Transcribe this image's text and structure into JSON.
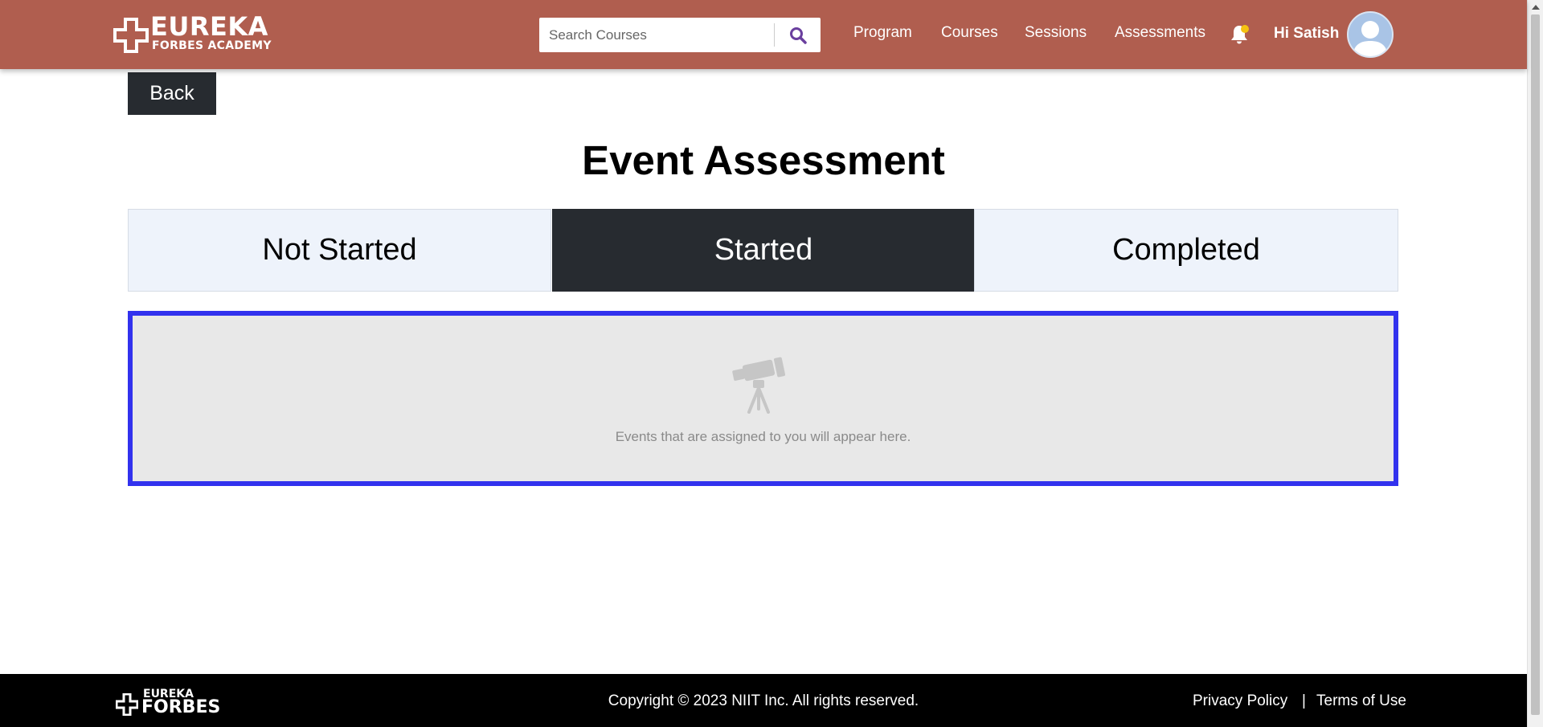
{
  "header": {
    "logo": {
      "title": "EUREKA",
      "subtitle": "FORBES ACADEMY"
    },
    "search": {
      "placeholder": "Search Courses",
      "value": ""
    },
    "nav": [
      {
        "label": "Program"
      },
      {
        "label": "Courses"
      },
      {
        "label": "Sessions"
      },
      {
        "label": "Assessments"
      }
    ],
    "greeting": "Hi Satish",
    "colors": {
      "bar": "#b05e4f",
      "search_icon": "#6a3f9e",
      "notification_dot": "#f5c211"
    }
  },
  "back_label": "Back",
  "page_title": "Event Assessment",
  "tabs": [
    {
      "label": "Not Started",
      "active": false
    },
    {
      "label": "Started",
      "active": true
    },
    {
      "label": "Completed",
      "active": false
    }
  ],
  "empty_state": {
    "icon": "telescope-icon",
    "message": "Events that are assigned to you will appear here.",
    "border_color": "#3232ee"
  },
  "footer": {
    "logo_top": "EUREKA",
    "logo_bottom": "FORBES",
    "copyright": "Copyright © 2023 NIIT Inc. All rights reserved.",
    "links": [
      {
        "label": "Privacy Policy"
      },
      {
        "label": "Terms of Use"
      }
    ],
    "separator": "|"
  }
}
